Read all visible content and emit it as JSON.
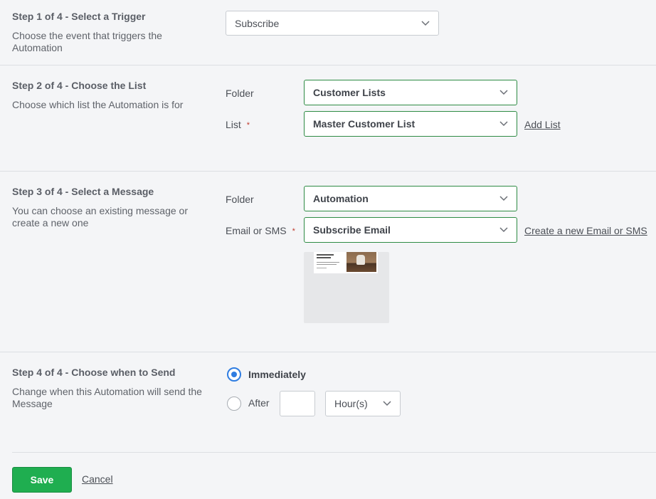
{
  "step1": {
    "title": "Step 1 of 4 - Select a Trigger",
    "description": "Choose the event that triggers the Automation",
    "trigger_value": "Subscribe"
  },
  "step2": {
    "title": "Step 2 of 4 - Choose the List",
    "description": "Choose which list the Automation is for",
    "folder_label": "Folder",
    "folder_value": "Customer Lists",
    "list_label": "List",
    "required_mark": "*",
    "list_value": "Master Customer List",
    "add_list_link": "Add List"
  },
  "step3": {
    "title": "Step 3 of 4 - Select a Message",
    "description": "You can choose an existing message or create a new one",
    "folder_label": "Folder",
    "folder_value": "Automation",
    "message_label": "Email or SMS",
    "required_mark": "*",
    "message_value": "Subscribe Email",
    "create_link": "Create a new Email or SMS"
  },
  "step4": {
    "title": "Step 4 of 4 - Choose when to Send",
    "description": "Change when this Automation will send the Message",
    "option_immediately": "Immediately",
    "option_after": "After",
    "after_value": "",
    "unit_value": "Hour(s)",
    "selected_option": "Immediately"
  },
  "actions": {
    "save_label": "Save",
    "cancel_label": "Cancel"
  },
  "colors": {
    "save_button": "#1fae50",
    "selected_border": "#2e8b44",
    "radio_selected": "#2f7de1"
  },
  "icons": {
    "dropdown": "chevron-down-icon"
  }
}
